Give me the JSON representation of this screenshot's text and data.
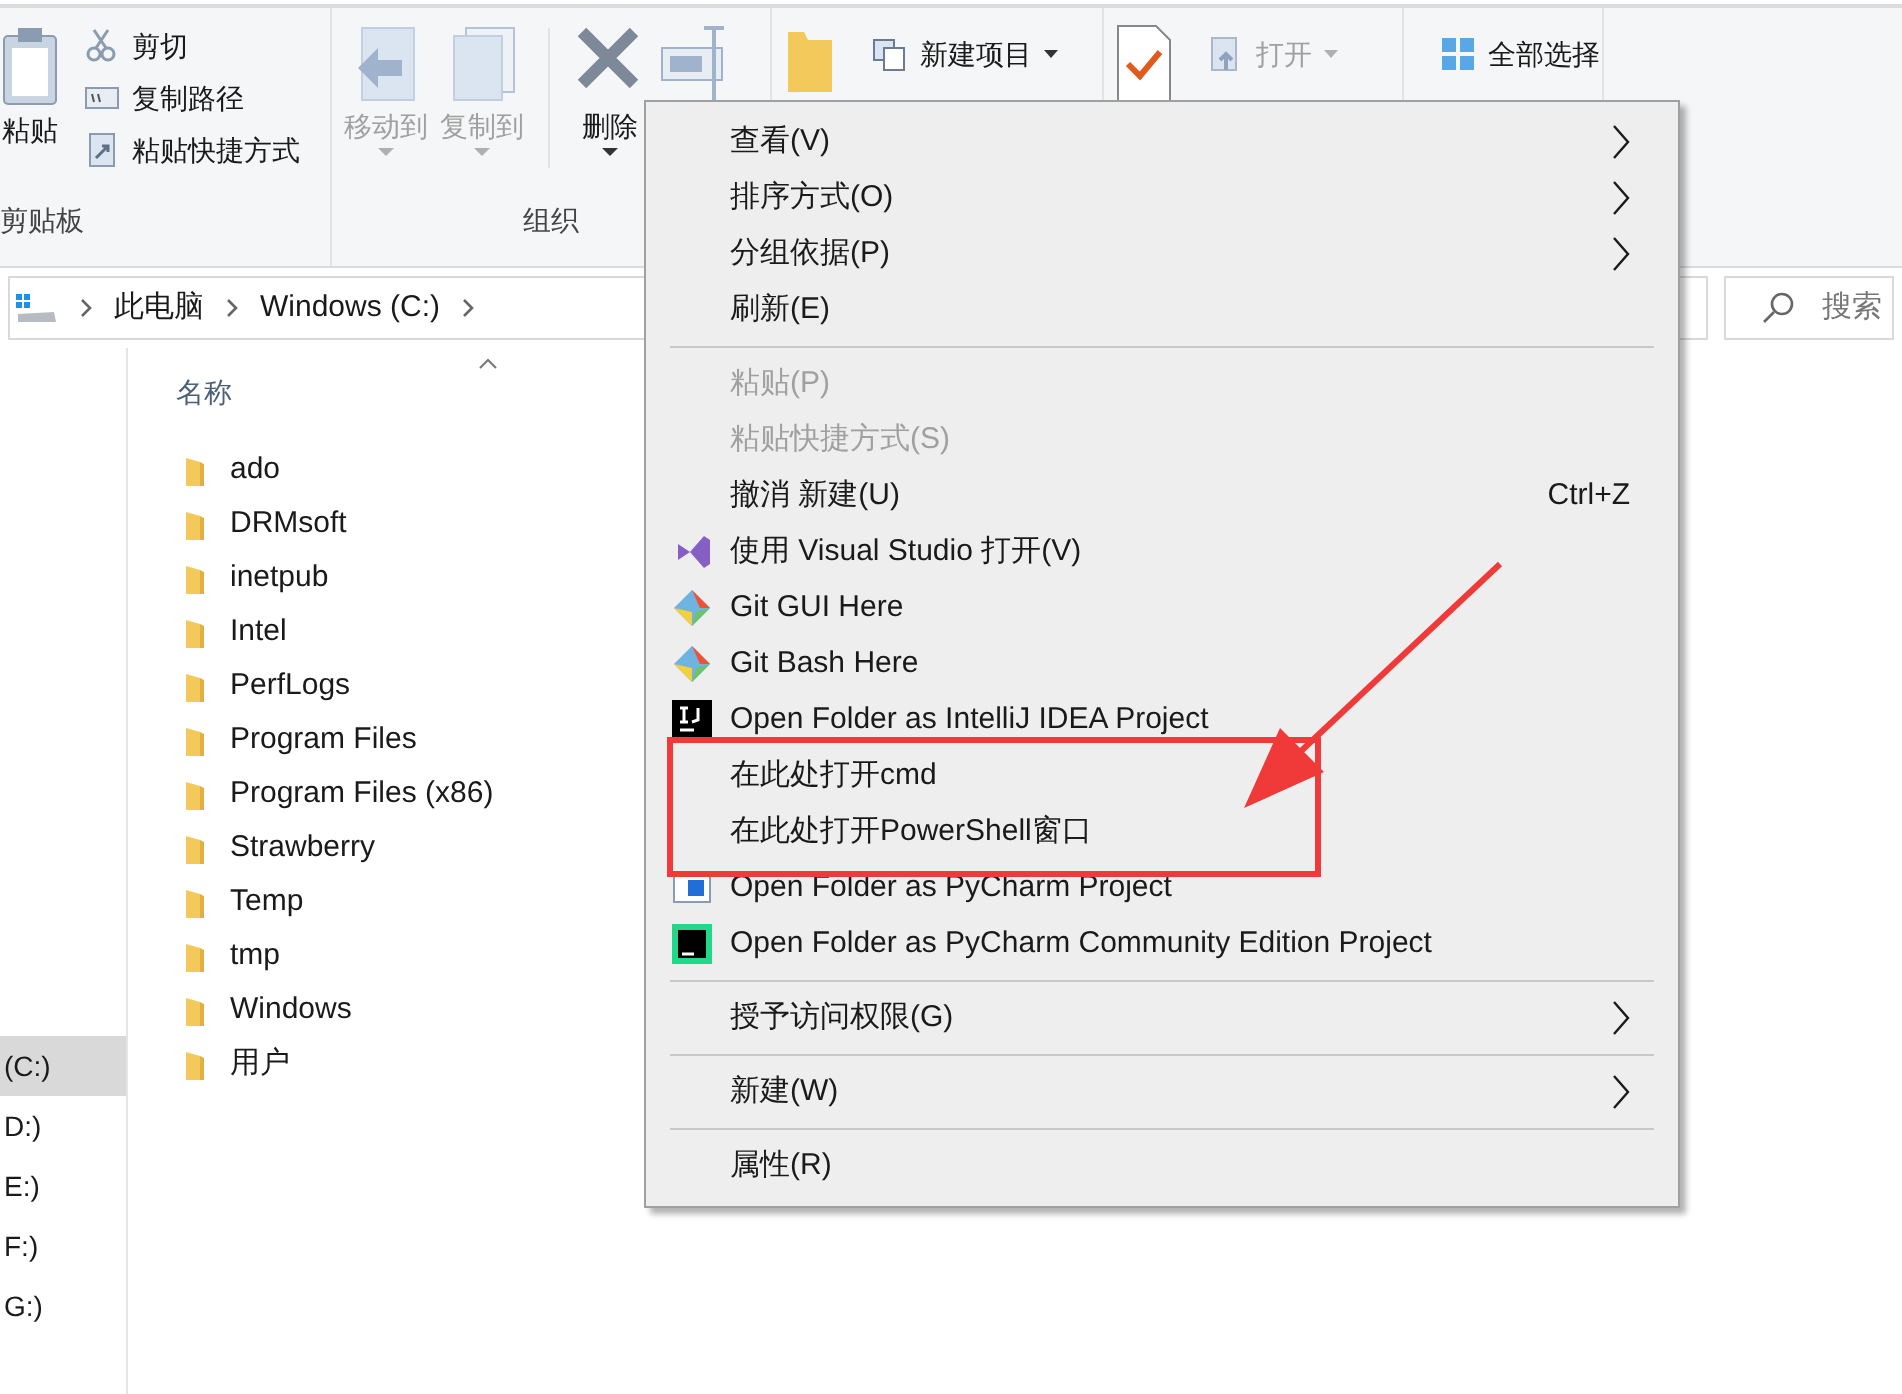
{
  "ribbon": {
    "groups": [
      {
        "label": "剪贴板",
        "large": [
          {
            "label": "粘贴",
            "disabled": false
          }
        ],
        "small": [
          {
            "label": "剪切",
            "disabled": false
          },
          {
            "label": "复制路径",
            "disabled": false
          },
          {
            "label": "粘贴快捷方式",
            "disabled": false
          }
        ]
      },
      {
        "label": "组织",
        "large": [
          {
            "label": "移动到",
            "disabled": true,
            "dropdown": true
          },
          {
            "label": "复制到",
            "disabled": true,
            "dropdown": true
          },
          {
            "label": "删除",
            "disabled": false,
            "dropdown": true
          }
        ]
      },
      {
        "small": [
          {
            "label": "新建项目",
            "disabled": false,
            "dropdown": true
          }
        ]
      },
      {
        "small": [
          {
            "label": "打开",
            "disabled": true,
            "dropdown": true
          }
        ]
      },
      {
        "small": [
          {
            "label": "全部选择",
            "disabled": false
          }
        ]
      }
    ]
  },
  "address_bar": {
    "path": [
      "此电脑",
      "Windows (C:)"
    ],
    "search_placeholder": "搜索"
  },
  "navigation": {
    "items": [
      {
        "label": "(C:)",
        "selected": true
      },
      {
        "label": "D:)",
        "selected": false
      },
      {
        "label": "E:)",
        "selected": false
      },
      {
        "label": "F:)",
        "selected": false
      },
      {
        "label": "G:)",
        "selected": false
      }
    ]
  },
  "file_list": {
    "column": "名称",
    "rows": [
      "ado",
      "DRMsoft",
      "inetpub",
      "Intel",
      "PerfLogs",
      "Program Files",
      "Program Files (x86)",
      "Strawberry",
      "Temp",
      "tmp",
      "Windows",
      "用户"
    ]
  },
  "context_menu": {
    "items": [
      {
        "kind": "command",
        "label": "查看(V)",
        "submenu": true,
        "disabled": false
      },
      {
        "kind": "command",
        "label": "排序方式(O)",
        "submenu": true,
        "disabled": false
      },
      {
        "kind": "command",
        "label": "分组依据(P)",
        "submenu": true,
        "disabled": false
      },
      {
        "kind": "command",
        "label": "刷新(E)",
        "submenu": false,
        "disabled": false
      },
      {
        "kind": "separator"
      },
      {
        "kind": "command",
        "label": "粘贴(P)",
        "submenu": false,
        "disabled": true
      },
      {
        "kind": "command",
        "label": "粘贴快捷方式(S)",
        "submenu": false,
        "disabled": true
      },
      {
        "kind": "command",
        "label": "撤消 新建(U)",
        "shortcut": "Ctrl+Z",
        "submenu": false,
        "disabled": false
      },
      {
        "kind": "command",
        "label": "使用 Visual Studio 打开(V)",
        "submenu": false,
        "disabled": false
      },
      {
        "kind": "command",
        "label": "Git GUI Here",
        "submenu": false,
        "disabled": false
      },
      {
        "kind": "command",
        "label": "Git Bash Here",
        "submenu": false,
        "disabled": false
      },
      {
        "kind": "command",
        "label": "Open Folder as IntelliJ IDEA Project",
        "submenu": false,
        "disabled": false
      },
      {
        "kind": "command",
        "label": "在此处打开cmd",
        "submenu": false,
        "disabled": false
      },
      {
        "kind": "command",
        "label": "在此处打开PowerShell窗口",
        "submenu": false,
        "disabled": false
      },
      {
        "kind": "command",
        "label": "Open Folder as PyCharm Project",
        "submenu": false,
        "disabled": false
      },
      {
        "kind": "command",
        "label": "Open Folder as PyCharm Community Edition Project",
        "submenu": false,
        "disabled": false
      },
      {
        "kind": "separator"
      },
      {
        "kind": "command",
        "label": "授予访问权限(G)",
        "submenu": true,
        "disabled": false
      },
      {
        "kind": "separator"
      },
      {
        "kind": "command",
        "label": "新建(W)",
        "submenu": true,
        "disabled": false
      },
      {
        "kind": "separator"
      },
      {
        "kind": "command",
        "label": "属性(R)",
        "submenu": false,
        "disabled": false
      }
    ]
  }
}
